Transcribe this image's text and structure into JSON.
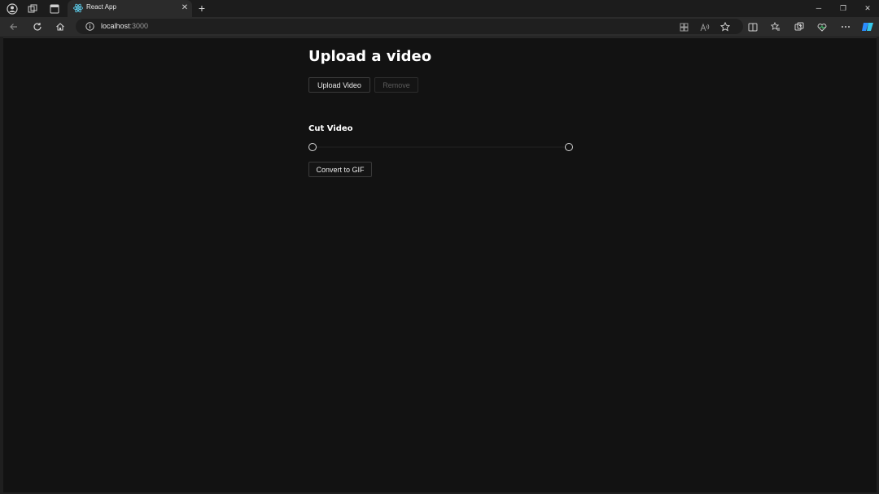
{
  "browser": {
    "tab": {
      "title": "React App"
    },
    "address": {
      "host": "localhost",
      "port": ":3000"
    },
    "new_tab_symbol": "+",
    "tab_close_symbol": "✕",
    "window_controls": {
      "minimize": "─",
      "restore": "❐",
      "close": "✕"
    },
    "icons": {
      "tab_bar": [
        "profile-icon",
        "workspaces-icon",
        "tab-actions-icon"
      ],
      "navigation": [
        "back-icon",
        "refresh-icon",
        "home-icon"
      ],
      "toolbar_right": [
        "app-available-icon",
        "read-aloud-icon",
        "favorite-star-icon",
        "split-screen-icon",
        "favorites-icon",
        "collections-icon",
        "browser-essentials-icon",
        "more-icon",
        "copilot-icon"
      ]
    }
  },
  "page": {
    "heading": "Upload a video",
    "upload_button": "Upload Video",
    "remove_button": "Remove",
    "cut_heading": "Cut Video",
    "convert_button": "Convert to GIF",
    "slider": {
      "start": 0,
      "end": 1
    }
  }
}
